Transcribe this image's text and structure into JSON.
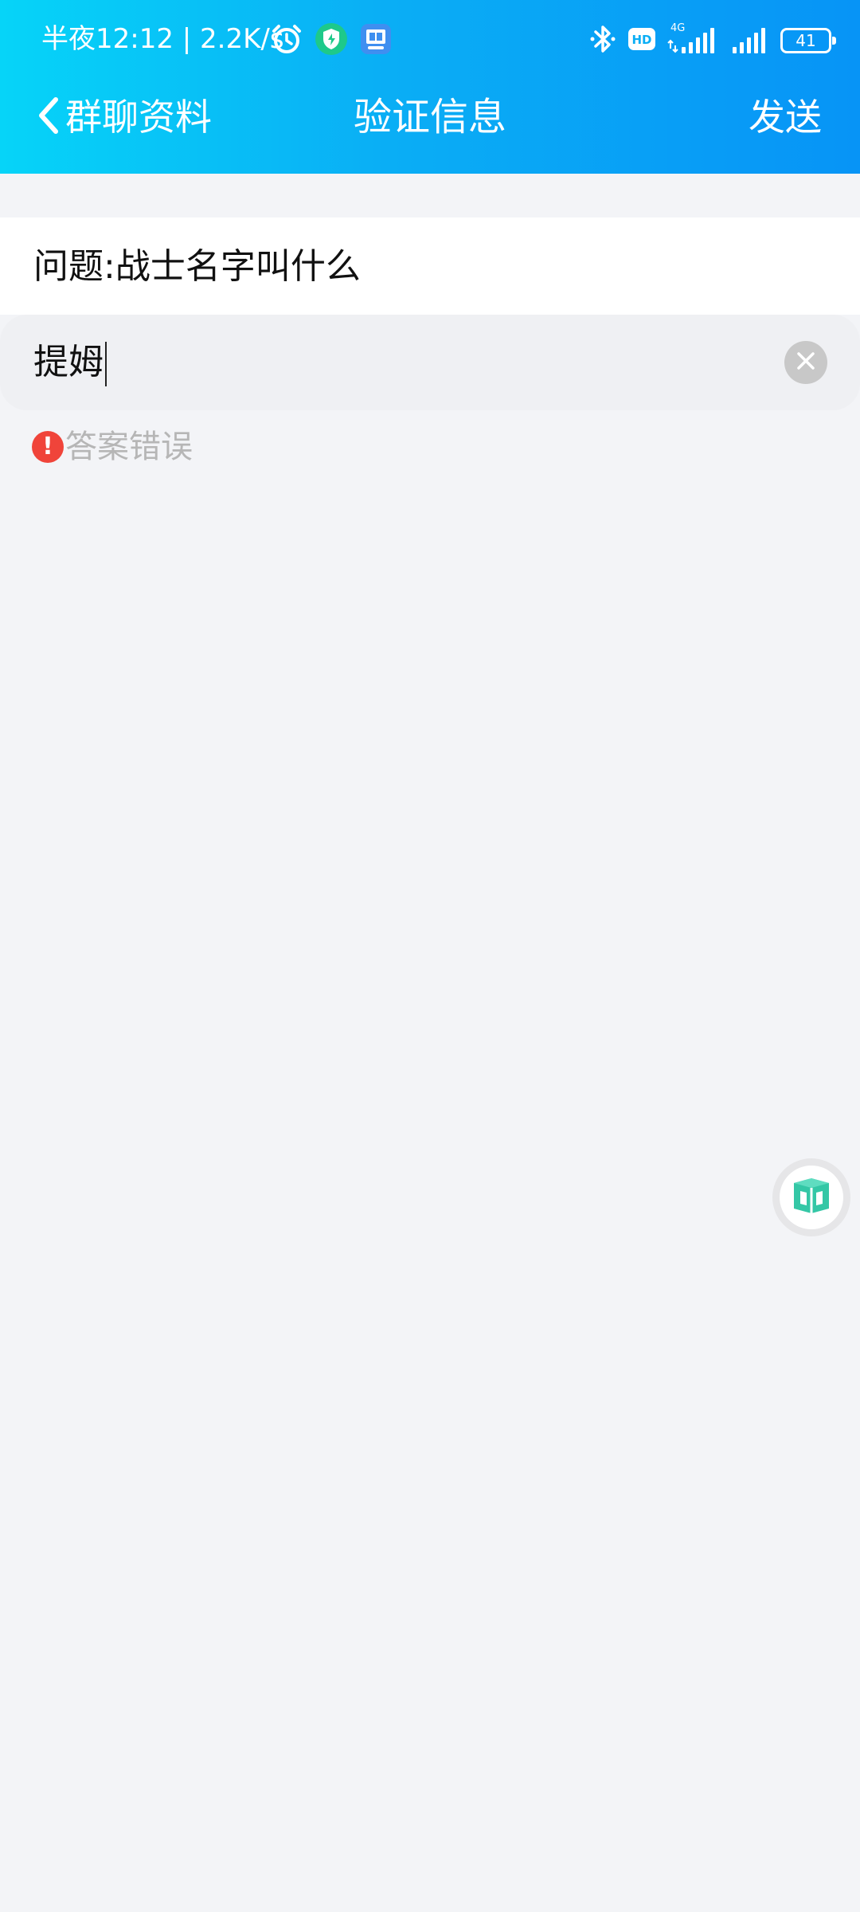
{
  "status_bar": {
    "time": "半夜12:12 | 2.2K/s",
    "icons": [
      "alarm-icon",
      "security-shield-icon",
      "app-notification-icon",
      "bluetooth-icon",
      "hd-voice-icon",
      "4g-signal-icon",
      "signal-icon",
      "battery-icon"
    ],
    "network_label": "4G",
    "hd_label": "HD",
    "battery_level": "41"
  },
  "nav": {
    "back_label": "群聊资料",
    "title": "验证信息",
    "send_label": "发送"
  },
  "question": {
    "text": "问题:战士名字叫什么"
  },
  "answer": {
    "value": "提姆"
  },
  "error": {
    "message": "答案错误"
  },
  "colors": {
    "header_gradient_start": "#06d4f8",
    "header_gradient_end": "#0794f6",
    "error_red": "#f0443a",
    "background": "#f3f4f7"
  }
}
